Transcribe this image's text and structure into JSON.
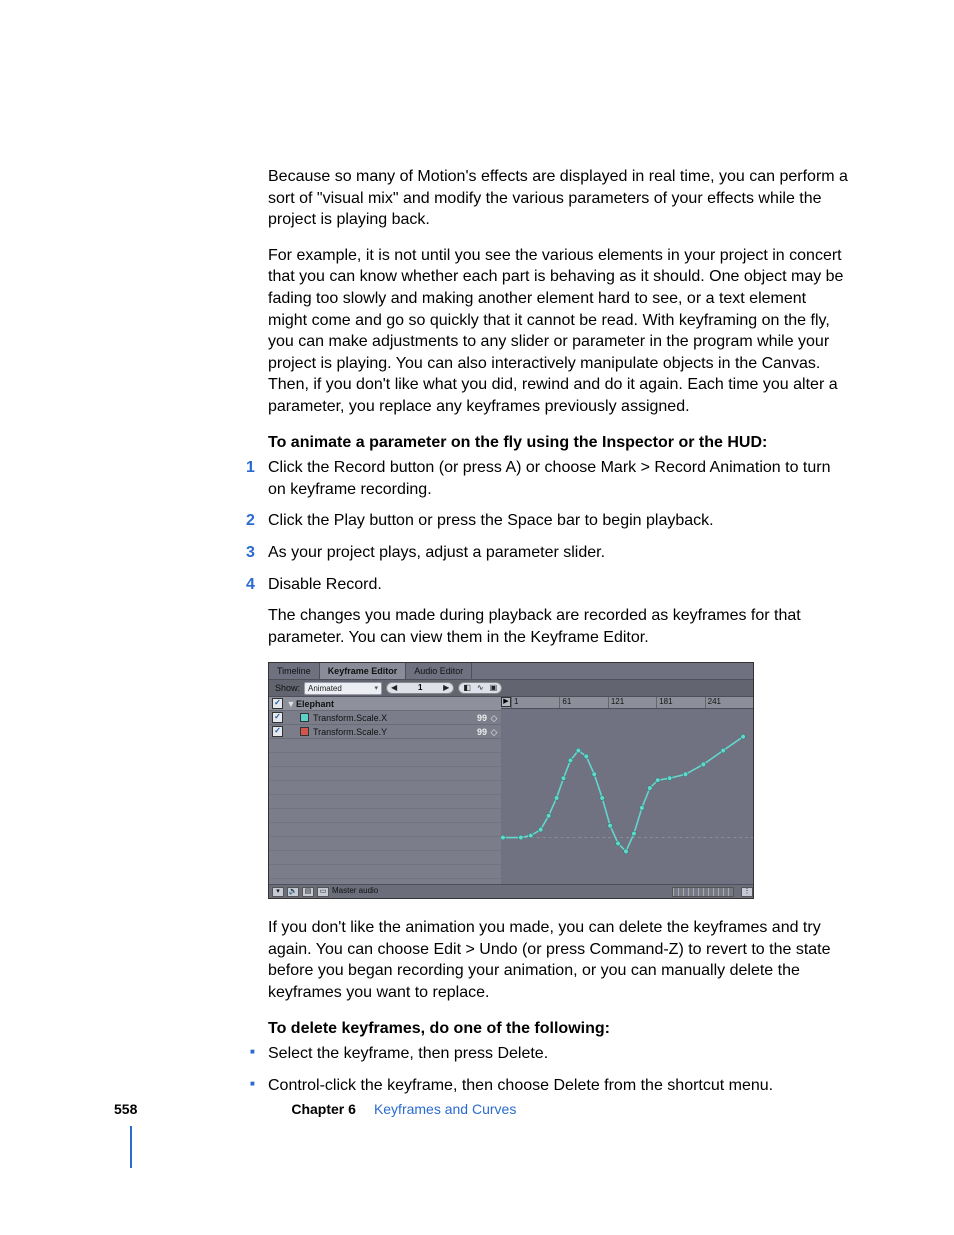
{
  "body": {
    "para1": "Because so many of Motion's effects are displayed in real time, you can perform a sort of \"visual mix\" and modify the various parameters of your effects while the project is playing back.",
    "para2": "For example, it is not until you see the various elements in your project in concert that you can know whether each part is behaving as it should. One object may be fading too slowly and making another element hard to see, or a text element might come and go so quickly that it cannot be read. With keyframing on the fly, you can make adjustments to any slider or parameter in the program while your project is playing. You can also interactively manipulate objects in the Canvas. Then, if you don't like what you did, rewind and do it again. Each time you alter a parameter, you replace any keyframes previously assigned.",
    "heading1": "To animate a parameter on the fly using the Inspector or the HUD:",
    "steps": [
      "Click the Record button (or press A) or choose Mark > Record Animation to turn on keyframe recording.",
      "Click the Play button or press the Space bar to begin playback.",
      "As your project plays, adjust a parameter slider.",
      "Disable Record."
    ],
    "post_steps": "The changes you made during playback are recorded as keyframes for that parameter. You can view them in the Keyframe Editor.",
    "para3": "If you don't like the animation you made, you can delete the keyframes and try again. You can choose Edit > Undo (or press Command-Z) to revert to the state before you began recording your animation, or you can manually delete the keyframes you want to replace.",
    "heading2": "To delete keyframes, do one of the following:",
    "bullets": [
      "Select the keyframe, then press Delete.",
      "Control-click the keyframe, then choose Delete from the shortcut menu."
    ]
  },
  "figure": {
    "tabs": {
      "timeline": "Timeline",
      "keyframe_editor": "Keyframe Editor",
      "audio_editor": "Audio Editor"
    },
    "toolbar": {
      "show_label": "Show:",
      "show_value": "Animated",
      "frame": "1"
    },
    "tree": {
      "group_name": "Elephant",
      "params": [
        {
          "name": "Transform.Scale.X",
          "value": "99"
        },
        {
          "name": "Transform.Scale.Y",
          "value": "99"
        }
      ]
    },
    "ruler_ticks": [
      "1",
      "61",
      "121",
      "181",
      "241"
    ],
    "bottom": {
      "label": "Master audio"
    }
  },
  "footer": {
    "page_number": "558",
    "chapter_label": "Chapter 6",
    "chapter_title": "Keyframes and Curves"
  }
}
